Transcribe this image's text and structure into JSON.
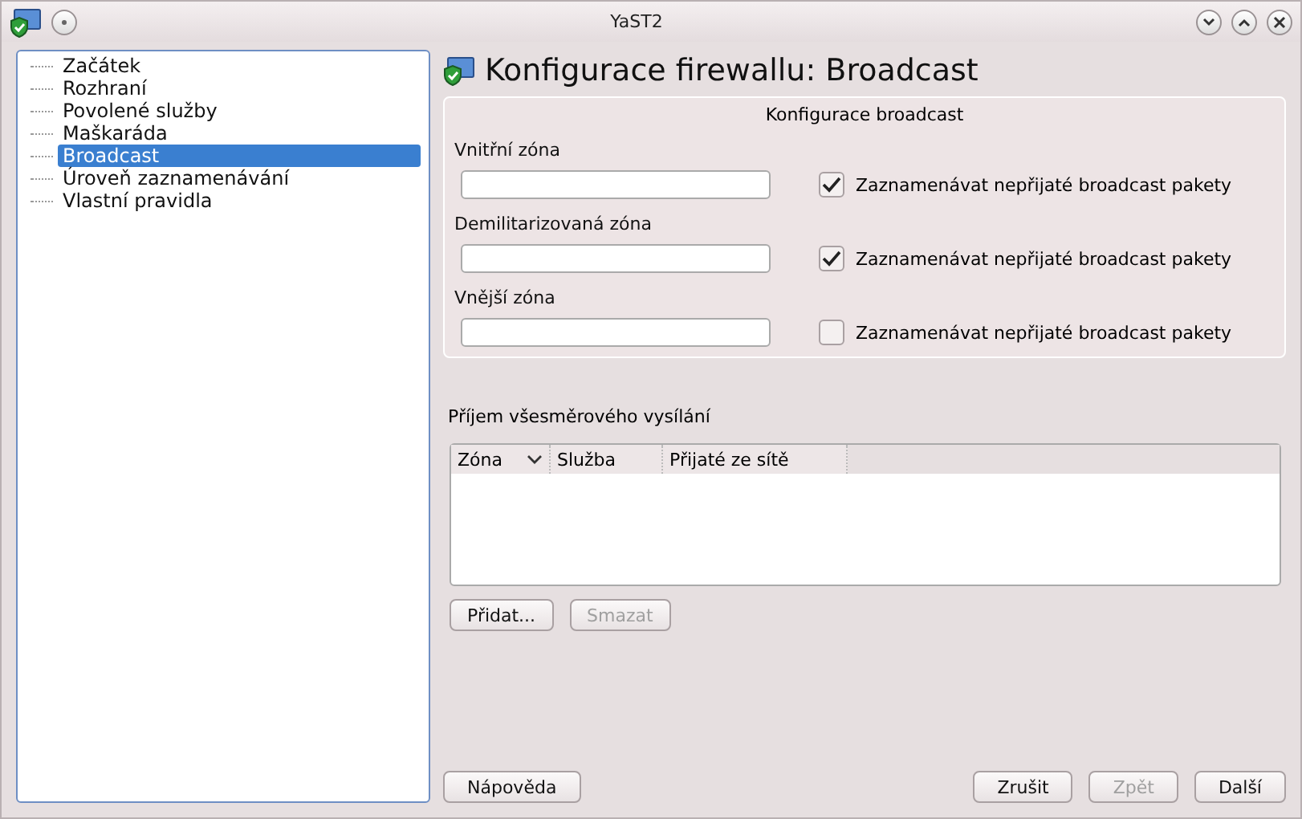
{
  "window": {
    "title": "YaST2"
  },
  "tree": {
    "items": [
      {
        "label": "Začátek",
        "selected": false
      },
      {
        "label": "Rozhraní",
        "selected": false
      },
      {
        "label": "Povolené služby",
        "selected": false
      },
      {
        "label": "Maškaráda",
        "selected": false
      },
      {
        "label": "Broadcast",
        "selected": true
      },
      {
        "label": "Úroveň zaznamenávání",
        "selected": false
      },
      {
        "label": "Vlastní pravidla",
        "selected": false
      }
    ]
  },
  "heading": "Konfigurace firewallu: Broadcast",
  "group": {
    "title": "Konfigurace broadcast",
    "zones": [
      {
        "label": "Vnitřní zóna",
        "log_label": "Zaznamenávat nepřijaté broadcast pakety",
        "checked": true
      },
      {
        "label": "Demilitarizovaná zóna",
        "log_label": "Zaznamenávat nepřijaté broadcast pakety",
        "checked": true
      },
      {
        "label": "Vnější zóna",
        "log_label": "Zaznamenávat nepřijaté broadcast pakety",
        "checked": false
      }
    ]
  },
  "reception": {
    "title": "Příjem všesměrového vysílání",
    "columns": [
      {
        "label": "Zóna",
        "sorted": true
      },
      {
        "label": "Služba",
        "sorted": false
      },
      {
        "label": "Přijaté ze sítě",
        "sorted": false
      }
    ],
    "buttons": [
      {
        "label": "Přidat...",
        "disabled": false
      },
      {
        "label": "Smazat",
        "disabled": true
      }
    ]
  },
  "footer": {
    "help": {
      "label": "Nápověda",
      "disabled": false
    },
    "buttons": [
      {
        "label": "Zrušit",
        "disabled": false
      },
      {
        "label": "Zpět",
        "disabled": true
      },
      {
        "label": "Další",
        "disabled": false
      }
    ]
  }
}
